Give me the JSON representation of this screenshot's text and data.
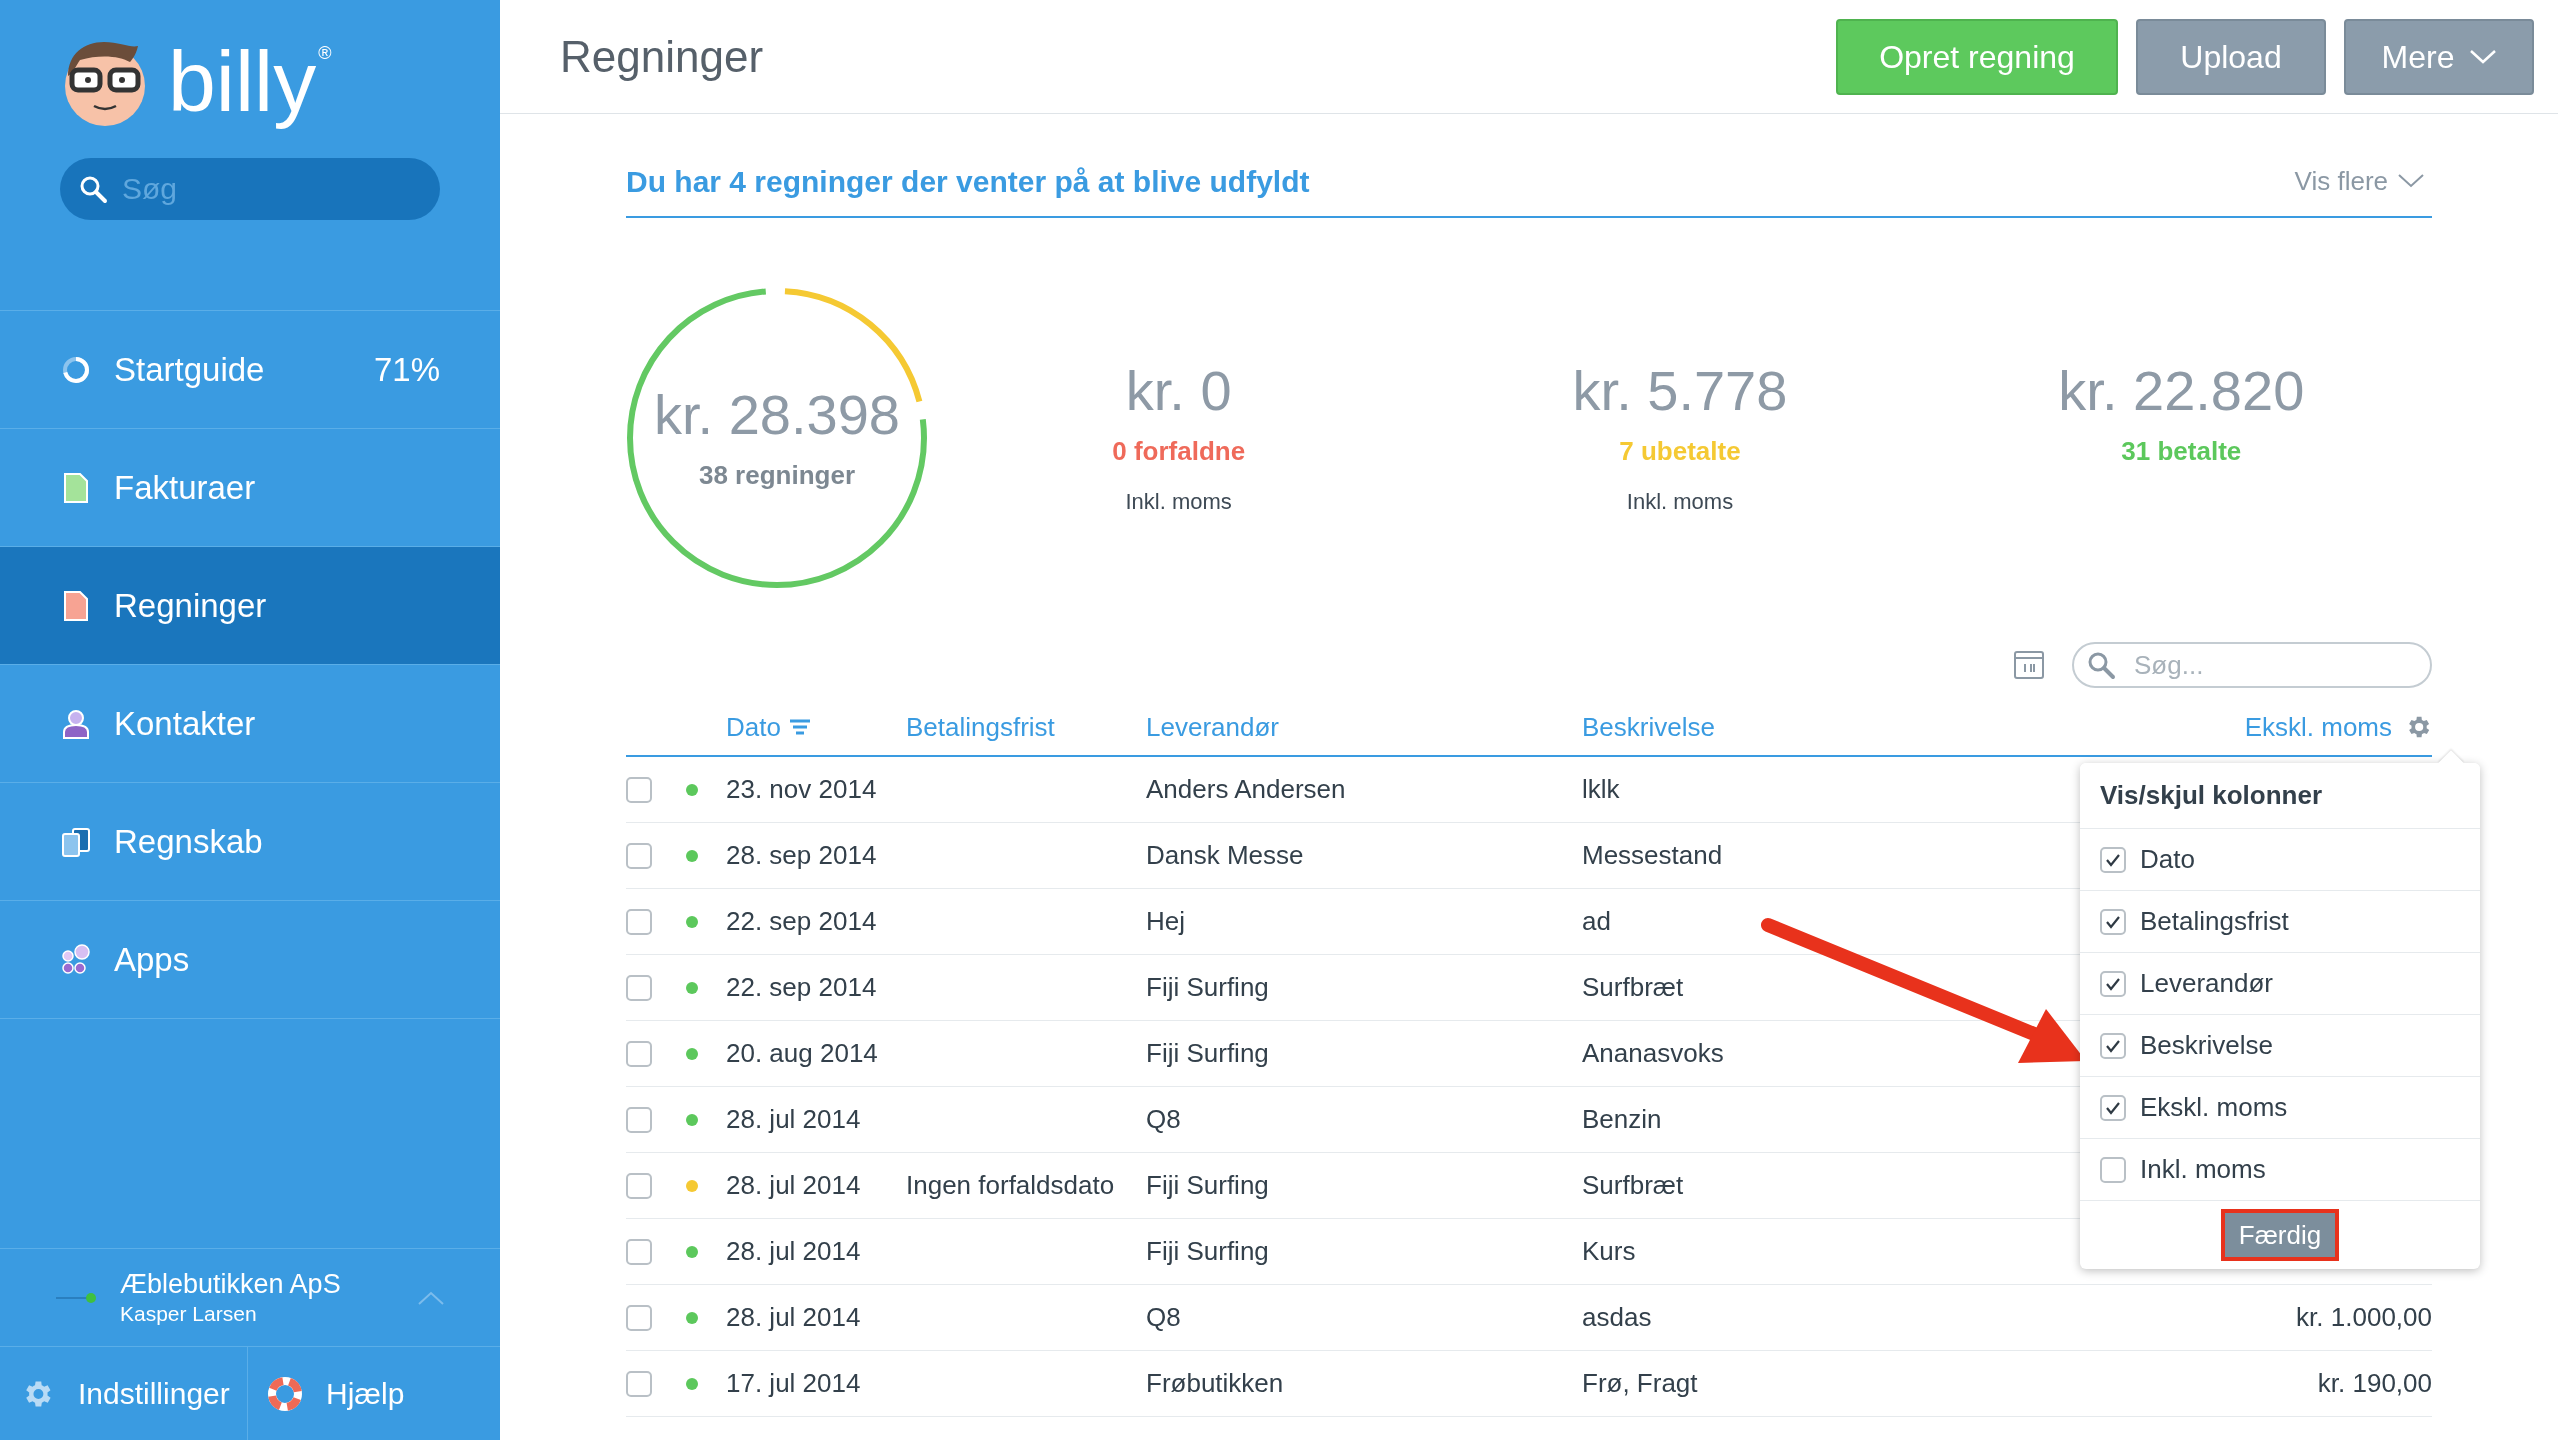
{
  "sidebar": {
    "logo": "billy",
    "logo_mark": "®",
    "search": {
      "placeholder": "Søg"
    },
    "items": [
      {
        "label": "Startguide",
        "badge": "71%",
        "kind": "progress",
        "selected": false
      },
      {
        "label": "Fakturaer",
        "kind": "invoice",
        "selected": false
      },
      {
        "label": "Regninger",
        "kind": "bill",
        "selected": true
      },
      {
        "label": "Kontakter",
        "kind": "contact",
        "selected": false
      },
      {
        "label": "Regnskab",
        "kind": "ledger",
        "selected": false
      },
      {
        "label": "Apps",
        "kind": "apps",
        "selected": false
      }
    ],
    "company": {
      "name": "Æblebutikken ApS",
      "user": "Kasper Larsen"
    },
    "footer": [
      {
        "label": "Indstillinger",
        "kind": "gear"
      },
      {
        "label": "Hjælp",
        "kind": "lifebuoy"
      }
    ]
  },
  "header": {
    "title": "Regninger",
    "buttons": [
      {
        "label": "Opret regning",
        "kind": "primary"
      },
      {
        "label": "Upload",
        "kind": "secondary"
      },
      {
        "label": "Mere",
        "kind": "dropdown"
      }
    ]
  },
  "notice": {
    "text": "Du har 4 regninger der venter på at blive udfyldt",
    "link": "Vis flere"
  },
  "summary": {
    "total": {
      "amount": "kr. 28.398",
      "label": "38 regninger"
    },
    "stats": [
      {
        "amount": "kr. 0",
        "label": "0 forfaldne",
        "color": "#ef6a5a",
        "note": "Inkl. moms"
      },
      {
        "amount": "kr. 5.778",
        "label": "7 ubetalte",
        "color": "#f5c933",
        "note": "Inkl. moms"
      },
      {
        "amount": "kr. 22.820",
        "label": "31 betalte",
        "color": "#5cc85c"
      }
    ]
  },
  "table": {
    "search": {
      "placeholder": "Søg..."
    },
    "columns": [
      {
        "label": "Dato",
        "sorted": true
      },
      {
        "label": "Betalingsfrist",
        "sorted": false
      },
      {
        "label": "Leverandør",
        "sorted": false
      },
      {
        "label": "Beskrivelse",
        "sorted": false
      },
      {
        "label": "Ekskl. moms",
        "sorted": false
      }
    ],
    "rows": [
      {
        "checked": false,
        "color": "#5cc85c",
        "date": "23. nov 2014",
        "vendor": "Anders Andersen",
        "description": "lklk"
      },
      {
        "checked": false,
        "color": "#5cc85c",
        "date": "28. sep 2014",
        "vendor": "Dansk Messe",
        "description": "Messestand"
      },
      {
        "checked": false,
        "color": "#5cc85c",
        "date": "22. sep 2014",
        "vendor": "Hej",
        "description": "ad"
      },
      {
        "checked": false,
        "color": "#5cc85c",
        "date": "22. sep 2014",
        "vendor": "Fiji Surfing",
        "description": "Surfbræt"
      },
      {
        "checked": false,
        "color": "#5cc85c",
        "date": "20. aug 2014",
        "vendor": "Fiji Surfing",
        "description": "Ananasvoks"
      },
      {
        "checked": false,
        "color": "#5cc85c",
        "date": "28. jul 2014",
        "vendor": "Q8",
        "description": "Benzin"
      },
      {
        "checked": false,
        "color": "#f5c933",
        "date": "28. jul 2014",
        "due": "Ingen forfaldsdato",
        "vendor": "Fiji Surfing",
        "description": "Surfbræt"
      },
      {
        "checked": false,
        "color": "#5cc85c",
        "date": "28. jul 2014",
        "vendor": "Fiji Surfing",
        "description": "Kurs"
      },
      {
        "checked": false,
        "color": "#5cc85c",
        "date": "28. jul 2014",
        "vendor": "Q8",
        "description": "asdas",
        "amount": "kr. 1.000,00"
      },
      {
        "checked": false,
        "color": "#5cc85c",
        "date": "17. jul 2014",
        "vendor": "Frøbutikken",
        "description": "Frø, Fragt",
        "amount": "kr. 190,00"
      }
    ]
  },
  "column_menu": {
    "title": "Vis/skjul kolonner",
    "options": [
      {
        "label": "Dato",
        "checked": true
      },
      {
        "label": "Betalingsfrist",
        "checked": true
      },
      {
        "label": "Leverandør",
        "checked": true
      },
      {
        "label": "Beskrivelse",
        "checked": true
      },
      {
        "label": "Ekskl. moms",
        "checked": true
      },
      {
        "label": "Inkl. moms",
        "checked": false
      }
    ],
    "button": "Færdig"
  }
}
